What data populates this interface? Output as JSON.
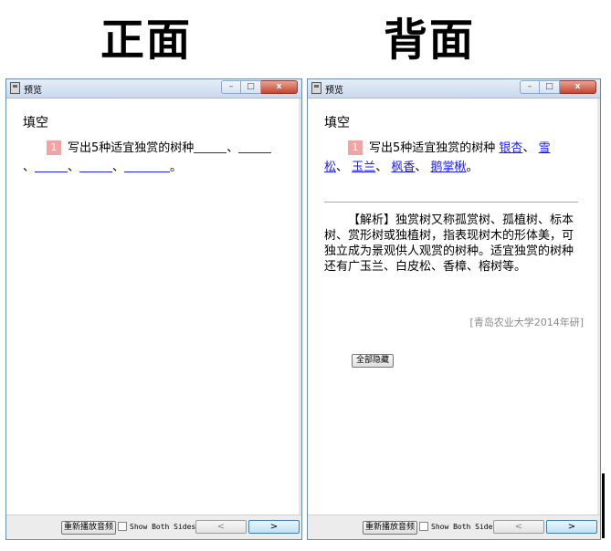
{
  "labels": {
    "front": "正面",
    "back": "背面"
  },
  "window": {
    "title": "预览",
    "min_symbol": "–",
    "max_symbol": "□",
    "close_symbol": "x"
  },
  "card": {
    "type": "填空",
    "number": "1",
    "prompt": "写出5种适宜独赏的树种",
    "separator": "、",
    "end": "。",
    "answers": [
      "银杏",
      "雪松",
      "玉兰",
      "枫香",
      "鹅掌楸"
    ]
  },
  "analysis": {
    "text": "【解析】独赏树又称孤赏树、孤植树、标本树、赏形树或独植树，指表现树木的形体美，可独立成为景观供人观赏的树种。适宜独赏的树种还有广玉兰、白皮松、香樟、榕树等。",
    "source": "[青岛农业大学2014年研]",
    "hide_all_label": "全部隐藏"
  },
  "footer": {
    "replay_label": "重新播放音频",
    "show_both_label": "Show Both Sides",
    "prev_label": "<",
    "next_label": ">"
  },
  "colors": {
    "answer": "#1a1aff",
    "badge": "#f2a3a3"
  }
}
